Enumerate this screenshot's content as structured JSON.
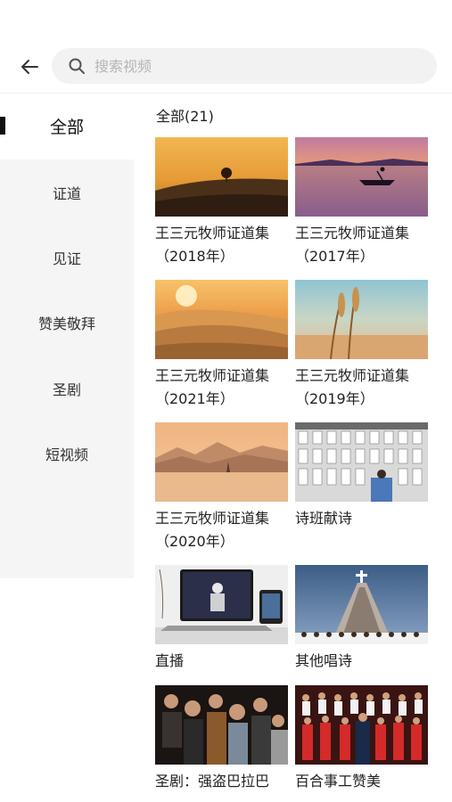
{
  "search": {
    "placeholder": "搜索视频"
  },
  "sidebar": {
    "items": [
      {
        "label": "全部",
        "active": true
      },
      {
        "label": "证道"
      },
      {
        "label": "见证"
      },
      {
        "label": "赞美敬拜"
      },
      {
        "label": "圣剧"
      },
      {
        "label": "短视频"
      }
    ]
  },
  "content": {
    "count_label": "全部(21)",
    "videos": [
      {
        "line1": "王三元牧师证道集",
        "line2": "（2018年）"
      },
      {
        "line1": "王三元牧师证道集",
        "line2": "（2017年）"
      },
      {
        "line1": "王三元牧师证道集",
        "line2": "（2021年）"
      },
      {
        "line1": "王三元牧师证道集",
        "line2": "（2019年）"
      },
      {
        "line1": "王三元牧师证道集",
        "line2": "（2020年）"
      },
      {
        "line1": "诗班献诗",
        "line2": ""
      },
      {
        "line1": "直播",
        "line2": ""
      },
      {
        "line1": "其他唱诗",
        "line2": ""
      },
      {
        "line1": "圣剧：强盗巴拉巴",
        "line2": ""
      },
      {
        "line1": "百合事工赞美",
        "line2": ""
      }
    ]
  },
  "icons": {
    "back": "arrow-left-icon",
    "search": "search-icon"
  }
}
